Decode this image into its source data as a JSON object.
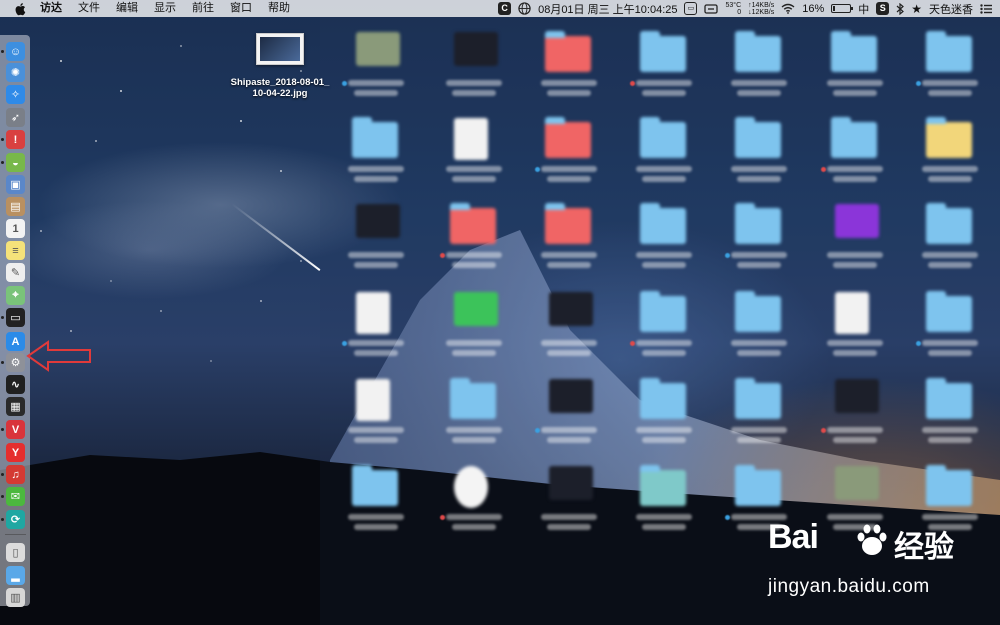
{
  "menubar": {
    "apple_icon": "apple-logo-icon",
    "menus": [
      "访达",
      "文件",
      "编辑",
      "显示",
      "前往",
      "窗口",
      "帮助"
    ],
    "status": {
      "c_icon_text": "C",
      "date_time": "08月01日 周三 上午10:04:25",
      "temperature_line1": "53°C",
      "temperature_line2": "0",
      "net_up": "↑14KB/s",
      "net_down": "↓12KB/s",
      "battery_percent": "16%",
      "battery_level": 0.16,
      "input_method": "中",
      "s_icon_text": "S",
      "user_name": "天色迷香"
    }
  },
  "desktop_file": {
    "name": "Shipaste_2018-08-01_10-04-22.jpg"
  },
  "dock": {
    "items": [
      {
        "name": "finder",
        "icon": "finder-icon",
        "color": "#3d8fe0",
        "glyph": "☺",
        "running": true
      },
      {
        "name": "launchpad",
        "icon": "launchpad-icon",
        "color": "#4a90d9",
        "glyph": "✺",
        "running": false
      },
      {
        "name": "safari",
        "icon": "safari-icon",
        "color": "#2f8ae8",
        "glyph": "✧",
        "running": false
      },
      {
        "name": "rocket",
        "icon": "rocket-icon",
        "color": "#7a7f88",
        "glyph": "➶",
        "running": false
      },
      {
        "name": "red-app",
        "icon": "red-app-icon",
        "color": "#d94040",
        "glyph": "!",
        "running": true
      },
      {
        "name": "android",
        "icon": "android-icon",
        "color": "#78b84a",
        "glyph": "◒",
        "running": true
      },
      {
        "name": "preview",
        "icon": "preview-icon",
        "color": "#5a87c9",
        "glyph": "▣",
        "running": false
      },
      {
        "name": "notebook",
        "icon": "notebook-icon",
        "color": "#b99061",
        "glyph": "▤",
        "running": false
      },
      {
        "name": "calendar",
        "icon": "calendar-icon",
        "color": "#f3f3f3",
        "glyph": "1",
        "running": false
      },
      {
        "name": "notes",
        "icon": "notes-icon",
        "color": "#f5e27a",
        "glyph": "≡",
        "running": false
      },
      {
        "name": "textedit",
        "icon": "textedit-icon",
        "color": "#eeeeee",
        "glyph": "✎",
        "running": false
      },
      {
        "name": "maps",
        "icon": "maps-icon",
        "color": "#7ac37a",
        "glyph": "⌖",
        "running": false
      },
      {
        "name": "terminal-dark",
        "icon": "terminal-icon",
        "color": "#222222",
        "glyph": "▭",
        "running": true
      },
      {
        "name": "app-store",
        "icon": "app-store-icon",
        "color": "#2b8be8",
        "glyph": "A",
        "running": false
      },
      {
        "name": "system-preferences",
        "icon": "gear-icon",
        "color": "#8e9199",
        "glyph": "⚙",
        "running": true
      },
      {
        "name": "activity-monitor",
        "icon": "activity-monitor-icon",
        "color": "#202020",
        "glyph": "∿",
        "running": false
      },
      {
        "name": "console",
        "icon": "console-icon",
        "color": "#2a2a2a",
        "glyph": "▦",
        "running": false
      },
      {
        "name": "vivaldi",
        "icon": "vivaldi-icon",
        "color": "#d9343b",
        "glyph": "V",
        "running": true
      },
      {
        "name": "yandex",
        "icon": "yandex-browser-icon",
        "color": "#e52e2e",
        "glyph": "Y",
        "running": false
      },
      {
        "name": "netease-music",
        "icon": "netease-music-icon",
        "color": "#d43a33",
        "glyph": "♫",
        "running": true
      },
      {
        "name": "wechat",
        "icon": "wechat-icon",
        "color": "#4cb83e",
        "glyph": "✉",
        "running": true
      },
      {
        "name": "teal-app",
        "icon": "teal-app-icon",
        "color": "#1fa7a2",
        "glyph": "⟳",
        "running": true
      },
      {
        "name": "documents",
        "icon": "documents-folder-icon",
        "color": "#dcdcdc",
        "glyph": "▯",
        "running": false
      },
      {
        "name": "downloads",
        "icon": "downloads-folder-icon",
        "color": "#5aa8e8",
        "glyph": "▂",
        "running": false
      },
      {
        "name": "trash",
        "icon": "trash-icon",
        "color": "#d7d7d7",
        "glyph": "▥",
        "running": false
      }
    ]
  },
  "annotation": {
    "arrow_color": "#e03a3a"
  },
  "watermark": {
    "logo_text": "Bai",
    "logo_cn": "经验",
    "url": "jingyan.baidu.com"
  }
}
